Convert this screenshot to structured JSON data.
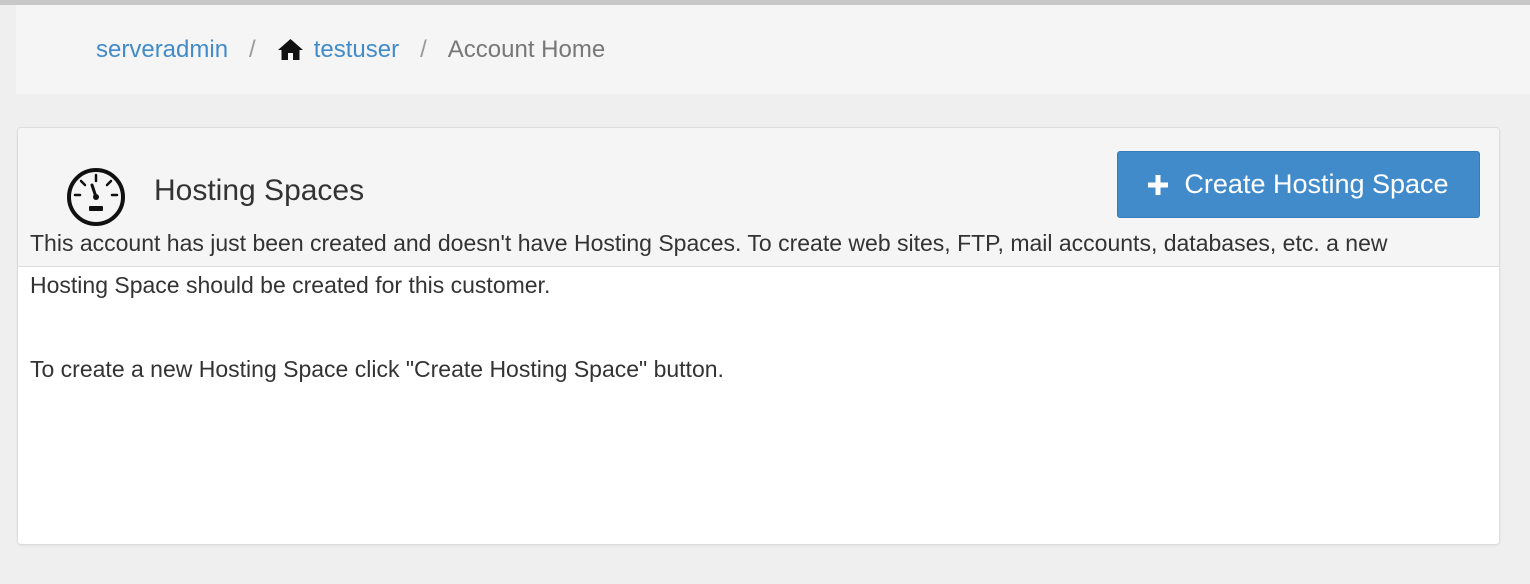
{
  "breadcrumb": {
    "items": [
      {
        "label": "serveradmin",
        "icon": ""
      },
      {
        "label": "testuser",
        "icon": "home-icon"
      },
      {
        "label": "Account Home",
        "icon": ""
      }
    ],
    "separator": "/"
  },
  "panel": {
    "icon": "gauge-icon",
    "title": "Hosting Spaces",
    "create_button": {
      "label": "Create Hosting Space",
      "icon": "plus-icon"
    },
    "messages": [
      "This account has just been created and doesn't have Hosting Spaces. To create web sites, FTP, mail accounts, databases, etc. a new Hosting Space should be created for this customer.",
      "To create a new Hosting Space click \"Create Hosting Space\" button."
    ]
  },
  "colors": {
    "link": "#428bca",
    "primary_button": "#428bca",
    "breadcrumb_bg": "#f5f5f5",
    "page_bg": "#efefef",
    "muted_text": "#777777"
  }
}
